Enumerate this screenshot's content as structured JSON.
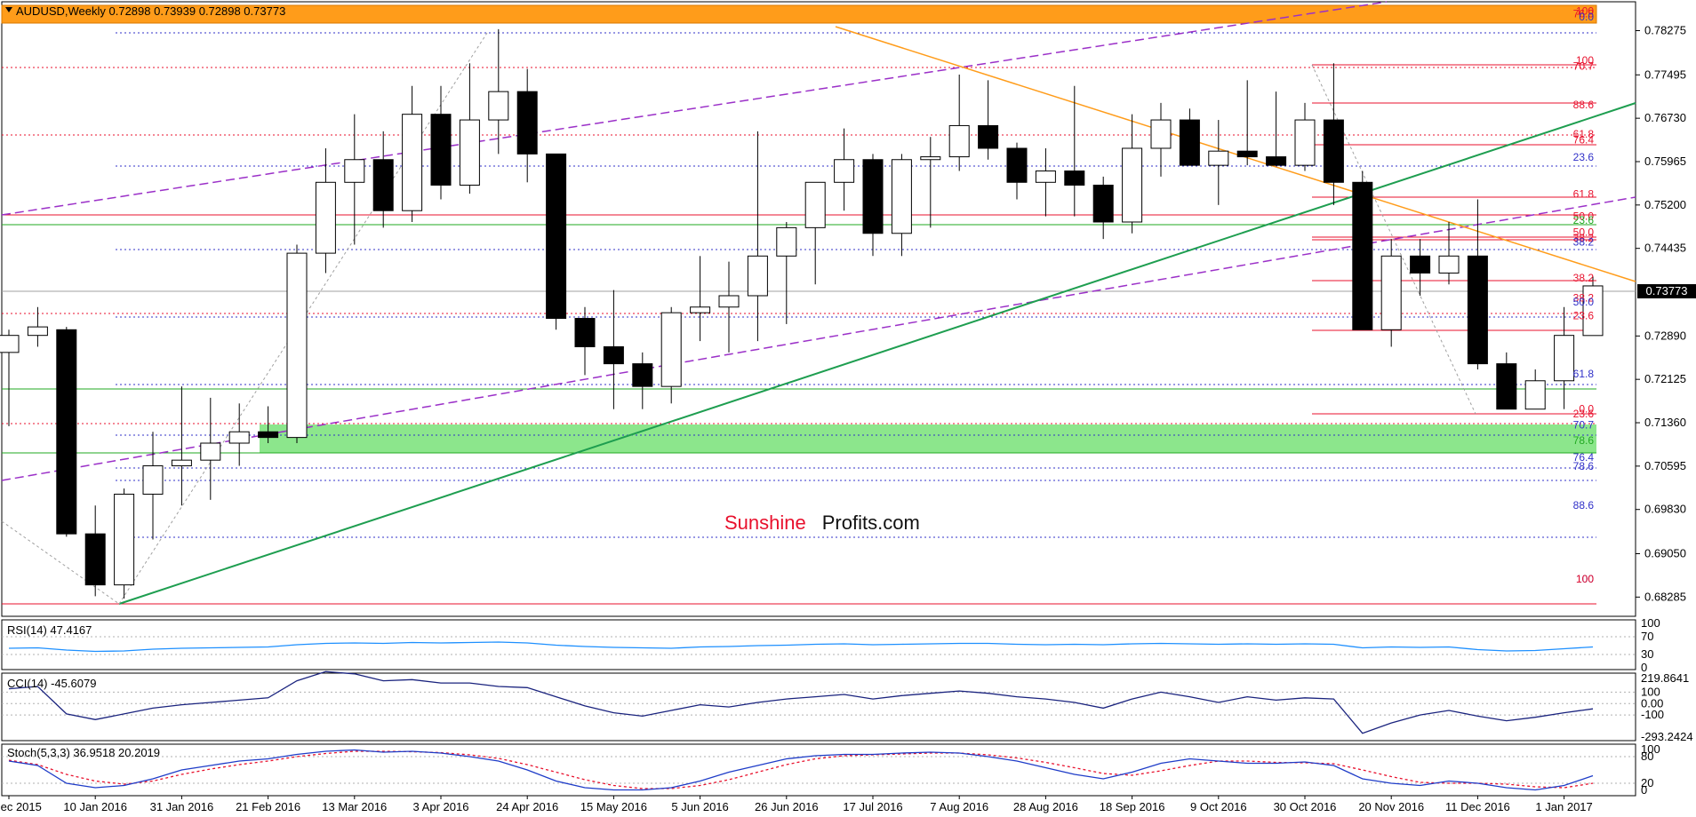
{
  "chart_data": {
    "type": "candlestick",
    "symbol": "AUDUSD",
    "timeframe": "Weekly",
    "header_ohlc": [
      "0.72898",
      "0.73939",
      "0.72898",
      "0.73773"
    ],
    "current_price": "0.73773",
    "ylim": [
      0.6804,
      0.7869
    ],
    "price_ticks": [
      "0.78275",
      "0.77495",
      "0.76730",
      "0.75965",
      "0.75200",
      "0.74435",
      "0.73773",
      "0.72890",
      "0.72125",
      "0.71360",
      "0.70595",
      "0.69830",
      "0.69050",
      "0.68285"
    ],
    "x_labels": [
      {
        "i": 0,
        "t": "20 Dec 2015"
      },
      {
        "i": 3,
        "t": "10 Jan 2016"
      },
      {
        "i": 6,
        "t": "31 Jan 2016"
      },
      {
        "i": 9,
        "t": "21 Feb 2016"
      },
      {
        "i": 12,
        "t": "13 Mar 2016"
      },
      {
        "i": 15,
        "t": "3 Apr 2016"
      },
      {
        "i": 18,
        "t": "24 Apr 2016"
      },
      {
        "i": 21,
        "t": "15 May 2016"
      },
      {
        "i": 24,
        "t": "5 Jun 2016"
      },
      {
        "i": 27,
        "t": "26 Jun 2016"
      },
      {
        "i": 30,
        "t": "17 Jul 2016"
      },
      {
        "i": 33,
        "t": "7 Aug 2016"
      },
      {
        "i": 36,
        "t": "28 Aug 2016"
      },
      {
        "i": 39,
        "t": "18 Sep 2016"
      },
      {
        "i": 42,
        "t": "9 Oct 2016"
      },
      {
        "i": 45,
        "t": "30 Oct 2016"
      },
      {
        "i": 48,
        "t": "20 Nov 2016"
      },
      {
        "i": 51,
        "t": "11 Dec 2016"
      },
      {
        "i": 54,
        "t": "1 Jan 2017"
      }
    ],
    "candles": [
      [
        0.726,
        0.73,
        0.713,
        0.729
      ],
      [
        0.729,
        0.734,
        0.727,
        0.7305
      ],
      [
        0.73,
        0.7305,
        0.6935,
        0.694
      ],
      [
        0.694,
        0.699,
        0.683,
        0.685
      ],
      [
        0.685,
        0.702,
        0.6826,
        0.701
      ],
      [
        0.701,
        0.712,
        0.693,
        0.706
      ],
      [
        0.706,
        0.72,
        0.699,
        0.707
      ],
      [
        0.707,
        0.718,
        0.7,
        0.71
      ],
      [
        0.71,
        0.717,
        0.706,
        0.712
      ],
      [
        0.712,
        0.7165,
        0.71,
        0.711
      ],
      [
        0.711,
        0.745,
        0.71,
        0.7435
      ],
      [
        0.7435,
        0.762,
        0.74,
        0.756
      ],
      [
        0.756,
        0.768,
        0.745,
        0.76
      ],
      [
        0.76,
        0.765,
        0.748,
        0.751
      ],
      [
        0.751,
        0.773,
        0.749,
        0.768
      ],
      [
        0.768,
        0.773,
        0.753,
        0.7555
      ],
      [
        0.7555,
        0.777,
        0.754,
        0.767
      ],
      [
        0.767,
        0.783,
        0.761,
        0.772
      ],
      [
        0.772,
        0.776,
        0.756,
        0.761
      ],
      [
        0.761,
        0.761,
        0.73,
        0.732
      ],
      [
        0.732,
        0.734,
        0.722,
        0.727
      ],
      [
        0.727,
        0.737,
        0.716,
        0.724
      ],
      [
        0.724,
        0.726,
        0.716,
        0.72
      ],
      [
        0.72,
        0.734,
        0.717,
        0.733
      ],
      [
        0.733,
        0.743,
        0.728,
        0.734
      ],
      [
        0.734,
        0.742,
        0.726,
        0.736
      ],
      [
        0.736,
        0.765,
        0.728,
        0.743
      ],
      [
        0.743,
        0.749,
        0.731,
        0.748
      ],
      [
        0.748,
        0.755,
        0.738,
        0.756
      ],
      [
        0.756,
        0.7655,
        0.751,
        0.76
      ],
      [
        0.76,
        0.761,
        0.743,
        0.747
      ],
      [
        0.747,
        0.761,
        0.743,
        0.76
      ],
      [
        0.76,
        0.764,
        0.748,
        0.7605
      ],
      [
        0.7605,
        0.775,
        0.758,
        0.766
      ],
      [
        0.766,
        0.774,
        0.76,
        0.762
      ],
      [
        0.762,
        0.763,
        0.753,
        0.756
      ],
      [
        0.756,
        0.762,
        0.75,
        0.758
      ],
      [
        0.758,
        0.773,
        0.75,
        0.7555
      ],
      [
        0.7555,
        0.757,
        0.746,
        0.749
      ],
      [
        0.749,
        0.768,
        0.747,
        0.762
      ],
      [
        0.762,
        0.77,
        0.757,
        0.767
      ],
      [
        0.767,
        0.769,
        0.759,
        0.759
      ],
      [
        0.759,
        0.767,
        0.752,
        0.7615
      ],
      [
        0.7615,
        0.774,
        0.759,
        0.7605
      ],
      [
        0.7605,
        0.772,
        0.759,
        0.759
      ],
      [
        0.759,
        0.77,
        0.758,
        0.767
      ],
      [
        0.767,
        0.777,
        0.752,
        0.756
      ],
      [
        0.756,
        0.758,
        0.73,
        0.73
      ],
      [
        0.73,
        0.746,
        0.727,
        0.743
      ],
      [
        0.743,
        0.746,
        0.736,
        0.74
      ],
      [
        0.74,
        0.749,
        0.738,
        0.743
      ],
      [
        0.743,
        0.753,
        0.723,
        0.724
      ],
      [
        0.724,
        0.726,
        0.716,
        0.716
      ],
      [
        0.716,
        0.723,
        0.716,
        0.721
      ],
      [
        0.721,
        0.734,
        0.716,
        0.729
      ],
      [
        0.72898,
        0.73939,
        0.72898,
        0.73773
      ]
    ],
    "fib_labels": [
      {
        "p": 0.7862,
        "t": "100",
        "c": "#e8112d"
      },
      {
        "p": 0.7857,
        "t": "76.8",
        "c": "#e8112d"
      },
      {
        "p": 0.7852,
        "t": "0.0",
        "c": "#3030c8"
      },
      {
        "p": 0.7775,
        "t": "100",
        "c": "#e8112d"
      },
      {
        "p": 0.7765,
        "t": "70.7",
        "c": "#e8112d"
      },
      {
        "p": 0.7697,
        "t": "88.6",
        "c": "#e8112d"
      },
      {
        "p": 0.7645,
        "t": "61.8",
        "c": "#e8112d"
      },
      {
        "p": 0.7635,
        "t": "76.4",
        "c": "#e8112d"
      },
      {
        "p": 0.7604,
        "t": "23.6",
        "c": "#3030c8"
      },
      {
        "p": 0.7539,
        "t": "61.8",
        "c": "#e8112d"
      },
      {
        "p": 0.75,
        "t": "50.0",
        "c": "#e8112d"
      },
      {
        "p": 0.7493,
        "t": "23.6",
        "c": "#22aa22"
      },
      {
        "p": 0.7472,
        "t": "50.0",
        "c": "#e8112d"
      },
      {
        "p": 0.7462,
        "t": "38.2",
        "c": "#e8112d"
      },
      {
        "p": 0.7455,
        "t": "38.2",
        "c": "#3030c8"
      },
      {
        "p": 0.7391,
        "t": "38.2",
        "c": "#e8112d"
      },
      {
        "p": 0.7356,
        "t": "38.2",
        "c": "#e8112d"
      },
      {
        "p": 0.7349,
        "t": "50.0",
        "c": "#3030c8"
      },
      {
        "p": 0.7325,
        "t": "23.6",
        "c": "#e8112d"
      },
      {
        "p": 0.7222,
        "t": "61.8",
        "c": "#3030c8"
      },
      {
        "p": 0.716,
        "t": "0.0",
        "c": "#e8112d"
      },
      {
        "p": 0.7152,
        "t": "23.6",
        "c": "#e8112d"
      },
      {
        "p": 0.7132,
        "t": "70.7",
        "c": "#3030c8"
      },
      {
        "p": 0.7105,
        "t": "78.6",
        "c": "#22aa22"
      },
      {
        "p": 0.7075,
        "t": "76.4",
        "c": "#3030c8"
      },
      {
        "p": 0.7059,
        "t": "78.6",
        "c": "#3030c8"
      },
      {
        "p": 0.699,
        "t": "88.6",
        "c": "#3030c8"
      },
      {
        "p": 0.686,
        "t": "100",
        "c": "#3030c8"
      },
      {
        "p": 0.686,
        "t": "100",
        "c": "#e8112d"
      }
    ],
    "rsi": {
      "label": "RSI(14) 47.4167",
      "ticks": [
        "100",
        "70",
        "30",
        "0"
      ],
      "values": [
        44,
        45,
        40,
        37,
        38,
        42,
        44,
        45,
        46,
        47,
        52,
        55,
        56,
        55,
        57,
        56,
        57,
        58,
        56,
        51,
        48,
        46,
        45,
        44,
        47,
        48,
        50,
        51,
        53,
        54,
        52,
        53,
        54,
        55,
        55,
        53,
        52,
        53,
        52,
        54,
        55,
        54,
        53,
        54,
        53,
        54,
        53,
        45,
        47,
        46,
        47,
        41,
        38,
        39,
        43,
        47
      ]
    },
    "cci": {
      "label": "CCI(14) -45.6079",
      "ticks": [
        "219.8641",
        "100",
        "0.00",
        "-100",
        "-293.2424"
      ],
      "values": [
        130,
        150,
        -90,
        -140,
        -90,
        -40,
        -10,
        10,
        30,
        50,
        200,
        280,
        260,
        200,
        210,
        180,
        180,
        150,
        140,
        60,
        -20,
        -80,
        -110,
        -60,
        -10,
        -30,
        10,
        40,
        60,
        80,
        40,
        70,
        90,
        110,
        90,
        60,
        40,
        10,
        -40,
        40,
        100,
        60,
        10,
        60,
        30,
        50,
        40,
        -260,
        -170,
        -100,
        -60,
        -110,
        -150,
        -120,
        -80,
        -46
      ]
    },
    "stoch": {
      "label": "Stoch(5,3,3) 36.9518 20.2019",
      "ticks": [
        "100",
        "80",
        "20",
        "0"
      ],
      "k": [
        70,
        60,
        20,
        10,
        15,
        30,
        50,
        60,
        70,
        75,
        85,
        92,
        95,
        90,
        92,
        88,
        80,
        70,
        50,
        25,
        10,
        5,
        5,
        10,
        25,
        45,
        60,
        75,
        82,
        85,
        85,
        88,
        90,
        88,
        80,
        70,
        55,
        40,
        30,
        45,
        65,
        75,
        70,
        65,
        65,
        68,
        60,
        30,
        20,
        15,
        25,
        20,
        10,
        5,
        15,
        37
      ],
      "d": [
        72,
        62,
        40,
        25,
        18,
        25,
        40,
        52,
        62,
        70,
        80,
        87,
        92,
        92,
        91,
        89,
        84,
        76,
        62,
        45,
        28,
        15,
        8,
        8,
        15,
        28,
        45,
        62,
        75,
        82,
        84,
        86,
        88,
        88,
        84,
        77,
        67,
        55,
        42,
        38,
        48,
        60,
        70,
        70,
        67,
        66,
        64,
        50,
        35,
        22,
        20,
        20,
        18,
        12,
        10,
        20
      ]
    }
  }
}
